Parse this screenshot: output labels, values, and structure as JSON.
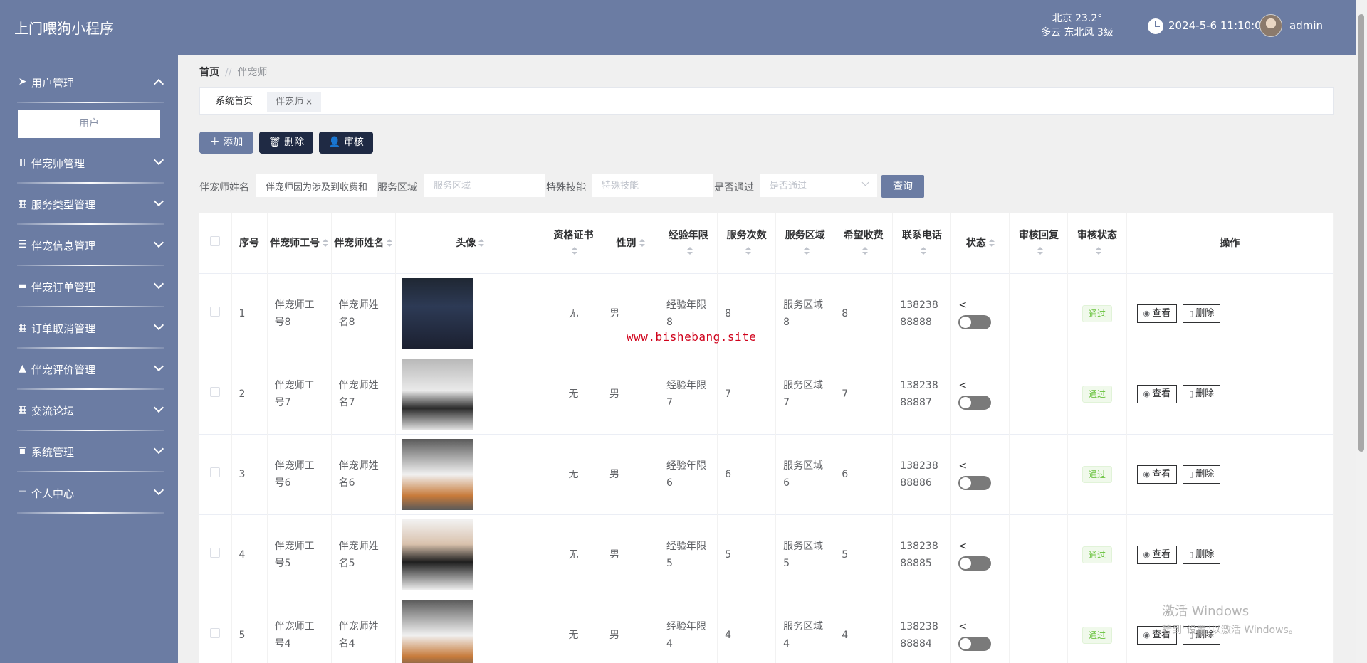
{
  "header": {
    "app_title": "上门喂狗小程序",
    "weather_line1": "北京  23.2°",
    "weather_line2": "多云  东北风  3级",
    "datetime": "2024-5-6 11:10:0",
    "username": "admin"
  },
  "sidebar": {
    "items": [
      {
        "label": "用户管理",
        "icon": "paper-plane-icon"
      },
      {
        "label": "伴宠师管理",
        "icon": "books-icon"
      },
      {
        "label": "服务类型管理",
        "icon": "grid-icon"
      },
      {
        "label": "伴宠信息管理",
        "icon": "sliders-icon"
      },
      {
        "label": "伴宠订单管理",
        "icon": "ticket-icon"
      },
      {
        "label": "订单取消管理",
        "icon": "grid-icon"
      },
      {
        "label": "伴宠评价管理",
        "icon": "thumbs-up-icon"
      },
      {
        "label": "交流论坛",
        "icon": "grid-icon"
      },
      {
        "label": "系统管理",
        "icon": "clipboard-icon"
      },
      {
        "label": "个人中心",
        "icon": "calendar-icon"
      }
    ],
    "submenu_user": "用户"
  },
  "breadcrumb": {
    "home": "首页",
    "sep": "//",
    "current": "伴宠师"
  },
  "tabs": {
    "home": "系统首页",
    "current": "伴宠师",
    "close": "×"
  },
  "toolbar": {
    "add": "添加",
    "delete": "删除",
    "audit": "审核"
  },
  "search": {
    "name_label": "伴宠师姓名",
    "name_value": "伴宠师因为涉及到收费和",
    "area_label": "服务区域",
    "area_placeholder": "服务区域",
    "skill_label": "特殊技能",
    "skill_placeholder": "特殊技能",
    "pass_label": "是否通过",
    "pass_placeholder": "是否通过",
    "query": "查询"
  },
  "table": {
    "headers": {
      "index": "序号",
      "worker_no": "伴宠师工号",
      "worker_name": "伴宠师姓名",
      "avatar": "头像",
      "cert": "资格证书",
      "gender": "性别",
      "years": "经验年限",
      "count": "服务次数",
      "area": "服务区域",
      "fee": "希望收费",
      "phone": "联系电话",
      "status": "状态",
      "reply": "审核回复",
      "audit_status": "审核状态",
      "ops": "操作"
    },
    "rows": [
      {
        "index": "1",
        "worker_no": "伴宠师工号8",
        "worker_name": "伴宠师姓名8",
        "cert": "无",
        "gender": "男",
        "years": "经验年限8",
        "count": "8",
        "area": "服务区域8",
        "fee": "8",
        "phone": "13823888888",
        "audit": "通过"
      },
      {
        "index": "2",
        "worker_no": "伴宠师工号7",
        "worker_name": "伴宠师姓名7",
        "cert": "无",
        "gender": "男",
        "years": "经验年限7",
        "count": "7",
        "area": "服务区域7",
        "fee": "7",
        "phone": "13823888887",
        "audit": "通过"
      },
      {
        "index": "3",
        "worker_no": "伴宠师工号6",
        "worker_name": "伴宠师姓名6",
        "cert": "无",
        "gender": "男",
        "years": "经验年限6",
        "count": "6",
        "area": "服务区域6",
        "fee": "6",
        "phone": "13823888886",
        "audit": "通过"
      },
      {
        "index": "4",
        "worker_no": "伴宠师工号5",
        "worker_name": "伴宠师姓名5",
        "cert": "无",
        "gender": "男",
        "years": "经验年限5",
        "count": "5",
        "area": "服务区域5",
        "fee": "5",
        "phone": "13823888885",
        "audit": "通过"
      },
      {
        "index": "5",
        "worker_no": "伴宠师工号4",
        "worker_name": "伴宠师姓名4",
        "cert": "无",
        "gender": "男",
        "years": "经验年限4",
        "count": "4",
        "area": "服务区域4",
        "fee": "4",
        "phone": "13823888884",
        "audit": "通过"
      }
    ],
    "view_label": "查看",
    "delete_label": "删除"
  },
  "watermark": "www.bishebang.site",
  "activate_windows": {
    "line1": "激活 Windows",
    "line2": "转到\"设置\"以激活 Windows。"
  },
  "colors": {
    "primary": "#6b7ca3",
    "dark": "#1f2a44",
    "success": "#67c23a"
  }
}
